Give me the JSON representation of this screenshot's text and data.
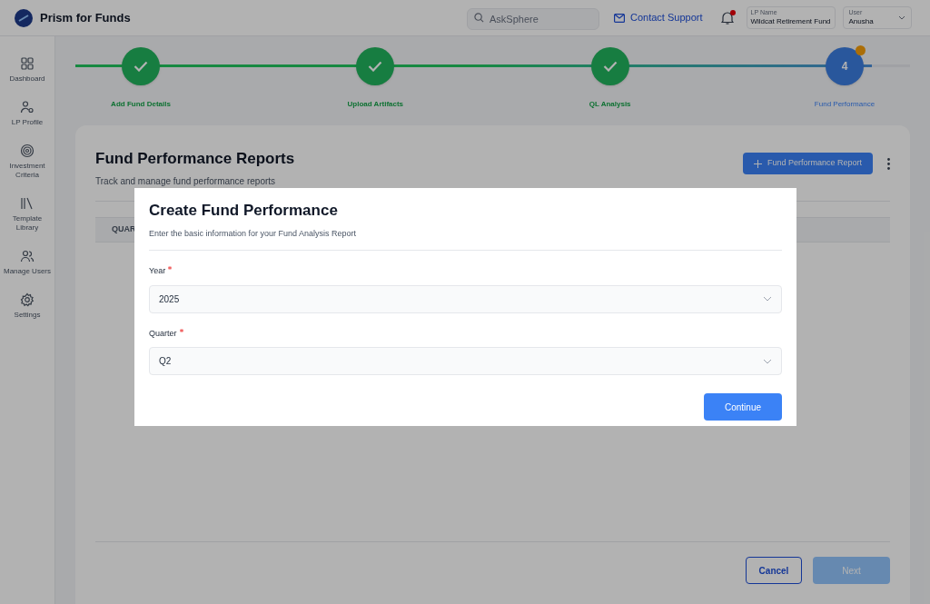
{
  "app": {
    "title": "Prism for Funds"
  },
  "header": {
    "search": {
      "placeholder": "AskSphere"
    },
    "contact": "Contact Support",
    "notification_unread": true,
    "lp": {
      "label": "LP Name",
      "value": "Wildcat Retirement Fund"
    },
    "user": {
      "label": "User",
      "value": "Anusha"
    }
  },
  "sidebar": {
    "items": [
      {
        "label": "Dashboard"
      },
      {
        "label": "LP Profile"
      },
      {
        "label": "Investment Criteria"
      },
      {
        "label": "Template Library"
      },
      {
        "label": "Manage Users"
      },
      {
        "label": "Settings"
      }
    ]
  },
  "stepper": [
    {
      "label": "Add Fund Details",
      "completed": true
    },
    {
      "label": "Upload Artifacts",
      "completed": true
    },
    {
      "label": "QL Analysis",
      "completed": true
    },
    {
      "label": "Fund Performance",
      "completed": false,
      "number": "4",
      "badge": true
    }
  ],
  "page": {
    "title": "Fund Performance Reports",
    "subtitle": "Track and manage fund performance reports",
    "add_button": "Fund Performance Report",
    "table": {
      "columns": [
        "QUAR"
      ]
    },
    "footer": {
      "cancel": "Cancel",
      "next": {
        "label": "Next",
        "disabled": true
      }
    }
  },
  "modal": {
    "title": "Create Fund Performance",
    "subtitle": "Enter the basic information for your Fund Analysis Report",
    "fields": [
      {
        "label": "Year",
        "required": true,
        "value": "2025"
      },
      {
        "label": "Quarter",
        "required": true,
        "value": "Q2"
      }
    ],
    "button": "Continue"
  }
}
